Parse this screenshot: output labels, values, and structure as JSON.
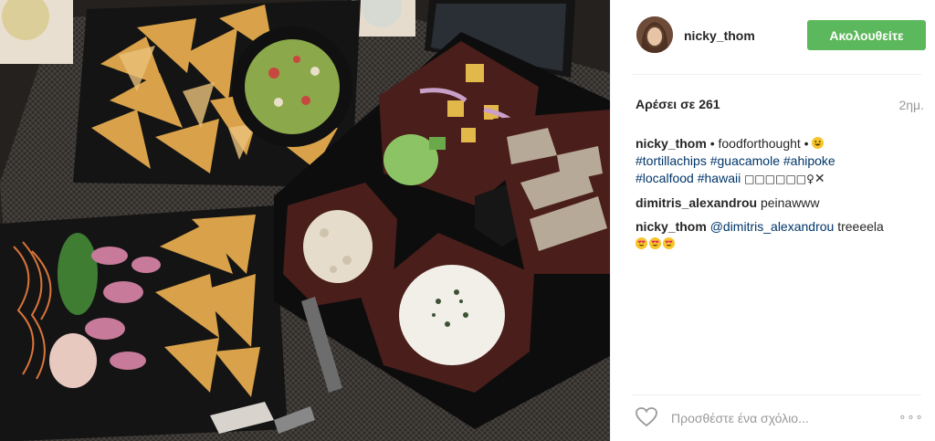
{
  "post": {
    "username": "nicky_thom",
    "follow_label": "Ακολουθείτε",
    "likes_text": "Αρέσει σε 261",
    "time_ago": "2ημ."
  },
  "caption": {
    "user": "nicky_thom",
    "text_prefix": "• foodforthought •",
    "tags_line1": [
      "#tortillachips",
      "#guacamole",
      "#ahipoke"
    ],
    "tags_line2": [
      "#localfood",
      "#hawaii"
    ],
    "glyphs": "□□□□□□♀",
    "x_mark": "✕"
  },
  "comments": [
    {
      "user": "dimitris_alexandrou",
      "text": "peinawww"
    },
    {
      "user": "nicky_thom",
      "mention": "@dimitris_alexandrou",
      "text": "treeeela"
    }
  ],
  "add_comment": {
    "placeholder": "Προσθέστε ένα σχόλιο...",
    "more_label": "∘∘∘"
  },
  "colors": {
    "follow_bg": "#5cb85c",
    "hashtag": "#003569",
    "muted": "#999999",
    "emoji": "#f7c52a"
  },
  "icons": [
    "heart-icon",
    "more-options-icon",
    "grin-emoji-icon",
    "heart-eyes-emoji-icon"
  ]
}
